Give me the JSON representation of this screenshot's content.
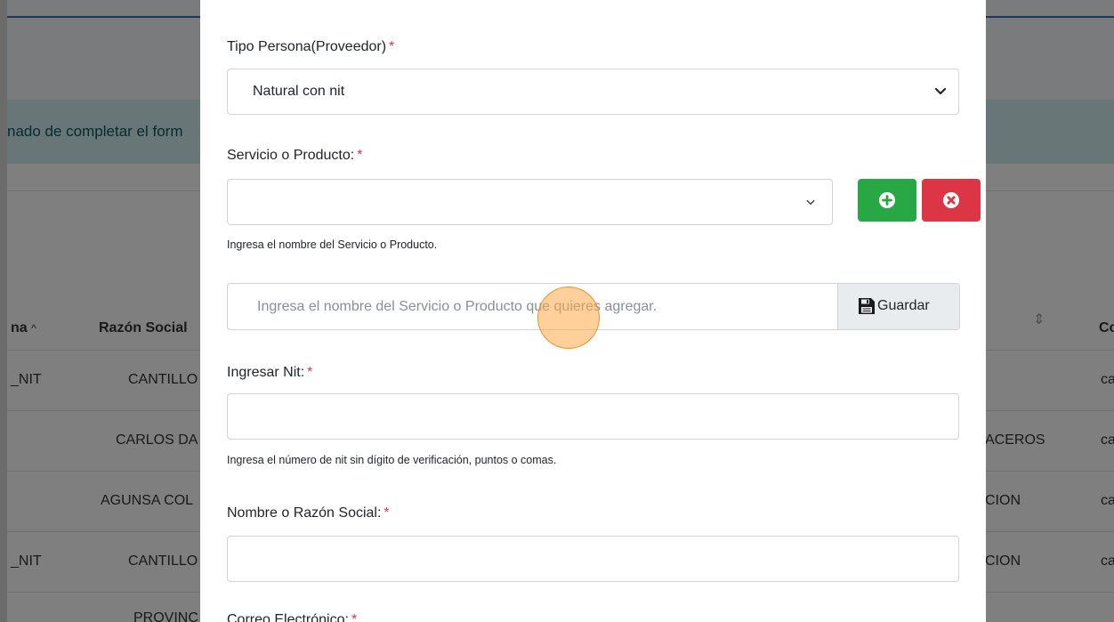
{
  "background": {
    "alert_text": "nado de completar el form",
    "columns": [
      {
        "label": "na"
      },
      {
        "label": "Razón Social"
      },
      {
        "label": "Co"
      }
    ],
    "rows": [
      {
        "c1": "_NIT",
        "c2": "CANTILLO",
        "c3": "",
        "c4": "ca"
      },
      {
        "c1": "",
        "c2": "CARLOS DA",
        "c3": "ACEROS",
        "c4": "ca"
      },
      {
        "c1": "",
        "c2": "AGUNSA COL",
        "c3": "CION",
        "c4": "ca"
      },
      {
        "c1": "_NIT",
        "c2": "CANTILLO",
        "c3": "CION",
        "c4": "ca"
      },
      {
        "c1": "",
        "c2": "PROVINC",
        "c3": "",
        "c4": ""
      }
    ]
  },
  "modal": {
    "tipo_persona": {
      "label": "Tipo Persona(Proveedor)",
      "required": "*",
      "value": "Natural con nit"
    },
    "servicio": {
      "label": "Servicio o Producto:",
      "required": "*",
      "value": "",
      "help": "Ingresa el nombre del Servicio o Producto."
    },
    "nuevo_servicio": {
      "placeholder": "Ingresa el nombre del Servicio o Producto que quieres agregar.",
      "save_label": "Guardar"
    },
    "nit": {
      "label": "Ingresar Nit:",
      "required": "*",
      "help": "Ingresa el número de nit sin dígito de verificación, puntos o comas."
    },
    "razon_social": {
      "label": "Nombre o Razón Social:",
      "required": "*"
    },
    "correo": {
      "label": "Correo Electrónico:",
      "required": "*"
    }
  },
  "colors": {
    "add_button": "#28a745",
    "remove_button": "#dc3545",
    "required": "#dc3545"
  },
  "icons": {
    "add": "plus-circle-icon",
    "remove": "times-circle-icon",
    "save": "floppy-disk-icon",
    "select": "chevron-down-icon"
  }
}
